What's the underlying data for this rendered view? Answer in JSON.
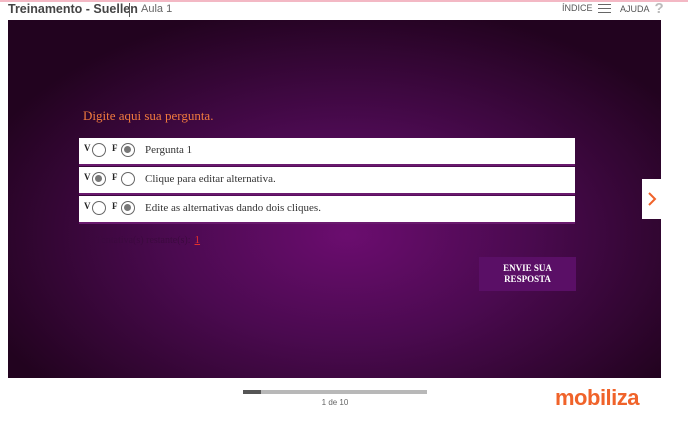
{
  "header": {
    "title": "Treinamento - Suellen",
    "lesson": "Aula 1",
    "index_label": "ÍNDICE",
    "help_label": "AJUDA",
    "icons": {
      "index": "hamburger-icon",
      "help": "question-icon"
    }
  },
  "quiz": {
    "question": "Digite aqui sua pergunta.",
    "true_label": "V",
    "false_label": "F",
    "options": [
      {
        "text": "Pergunta 1",
        "selected": "F"
      },
      {
        "text": "Clique para editar alternativa.",
        "selected": "V"
      },
      {
        "text": "Edite as alternativas dando dois cliques.",
        "selected": "F"
      }
    ],
    "attempts_label": "Tentativa(s) restante(s):",
    "attempts_value": "1",
    "submit_label_line1": "ENVIE SUA",
    "submit_label_line2": "RESPOSTA"
  },
  "navigation": {
    "next_icon": "chevron-right-icon",
    "page_label": "1 de 10",
    "progress": 0.1
  },
  "footer": {
    "brand": "mobiliza"
  },
  "colors": {
    "accent": "#f0632a",
    "question": "#f07a3e",
    "stage_center": "#6b0d6f",
    "stage_edge": "#22031f",
    "submit_bg": "#5a0f66",
    "attempts_value": "#e3322d"
  }
}
